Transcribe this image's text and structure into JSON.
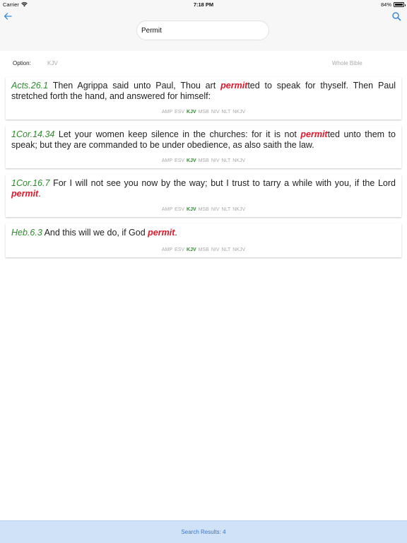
{
  "status": {
    "carrier": "Carrier",
    "time": "7:18 PM",
    "battery": "84%",
    "battery_level": 0.84,
    "wifi_icon": "wifi-icon",
    "battery_icon": "battery-icon"
  },
  "nav": {
    "back_icon": "arrow-left-icon",
    "search_icon": "search-icon",
    "search_value": "Permit",
    "accent": "#3a8ad8"
  },
  "options": {
    "label": "Option:",
    "version": "KJV",
    "scope": "Whole Bible"
  },
  "versions": [
    "AMP",
    "ESV",
    "KJV",
    "MSB",
    "NIV",
    "NLT",
    "NKJV"
  ],
  "active_version": "KJV",
  "colors": {
    "reference": "#2e8b2e",
    "highlight": "#e0182a",
    "footer_bg": "#cfe2f7",
    "footer_text": "#3a78c8"
  },
  "results": [
    {
      "ref": "Acts.26.1",
      "segments": [
        {
          "t": " Then Agrippa said unto Paul, Thou art "
        },
        {
          "t": "permit",
          "hl": true
        },
        {
          "t": "ted to speak for thyself. Then Paul stretched forth the hand, and answered for himself:"
        }
      ]
    },
    {
      "ref": "1Cor.14.34",
      "segments": [
        {
          "t": " Let your women keep silence in the churches: for it is not "
        },
        {
          "t": "permit",
          "hl": true
        },
        {
          "t": "ted unto them to speak; but they are commanded to be under obedience, as also saith the law."
        }
      ]
    },
    {
      "ref": "1Cor.16.7",
      "segments": [
        {
          "t": " For I will not see you now by the way; but I trust to tarry a while with you, if the Lord "
        },
        {
          "t": "permit",
          "hl": true
        },
        {
          "t": "."
        }
      ]
    },
    {
      "ref": "Heb.6.3",
      "segments": [
        {
          "t": " And this will we do, if God "
        },
        {
          "t": "permit",
          "hl": true
        },
        {
          "t": "."
        }
      ]
    }
  ],
  "footer": {
    "text": "Search Results: 4"
  }
}
